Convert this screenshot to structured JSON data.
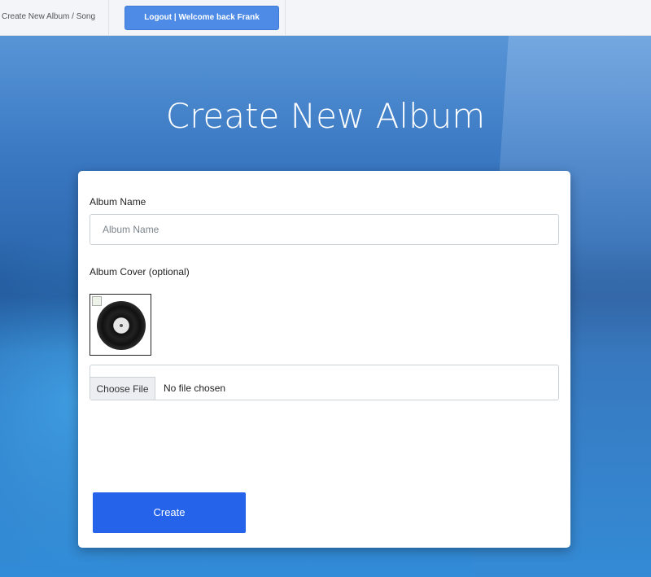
{
  "nav": {
    "link_label": "Create New Album / Song",
    "logout_label": "Logout | Welcome back Frank"
  },
  "page": {
    "title": "Create New Album"
  },
  "form": {
    "album_name_label": "Album Name",
    "album_name_placeholder": "Album Name",
    "album_name_value": "",
    "cover_label": "Album Cover (optional)",
    "cover_preview_icon": "vinyl-record-icon",
    "choose_file_label": "Choose File",
    "file_status": "No file chosen",
    "create_label": "Create"
  },
  "colors": {
    "primary_button": "#2563eb",
    "logout_button": "#4d8be6",
    "background": "#2e7ec4"
  }
}
